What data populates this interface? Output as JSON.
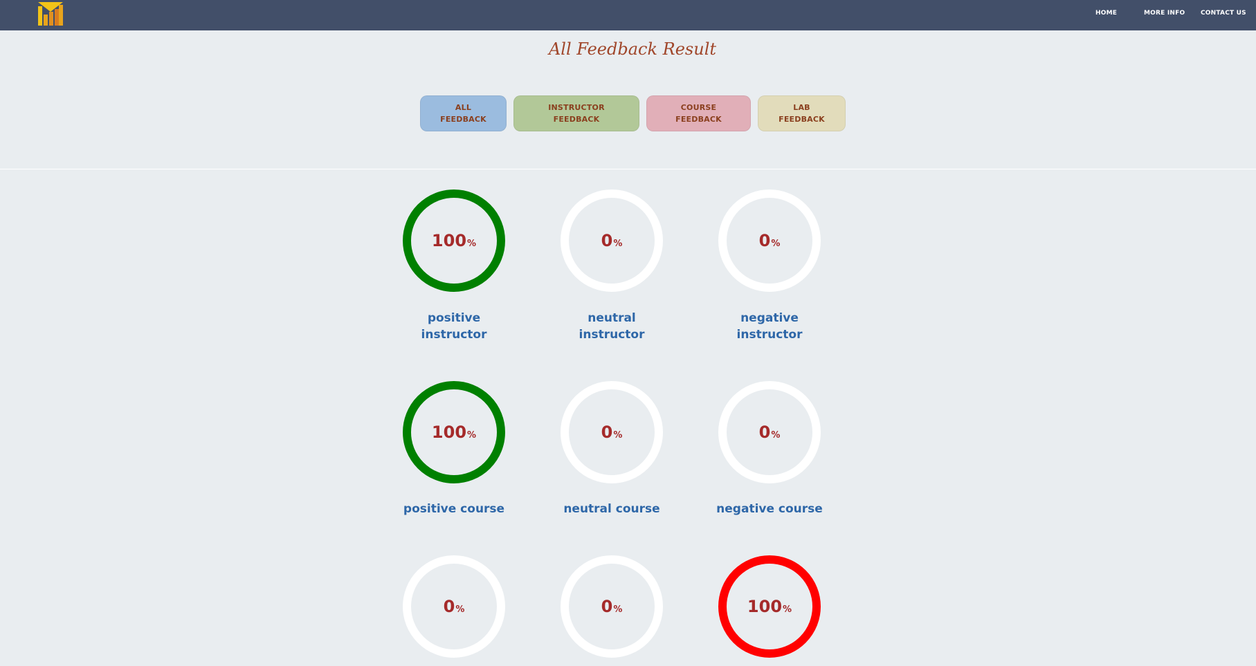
{
  "navbar": {
    "logo_icon": "bar-chart-logo-icon",
    "links": [
      {
        "label": "HOME"
      },
      {
        "label": "MORE INFO"
      },
      {
        "label": "CONTACT US"
      }
    ]
  },
  "page_title": "All Feedback Result",
  "filters": [
    {
      "line1": "ALL",
      "line2": "FEEDBACK",
      "color": "#9bbcdf"
    },
    {
      "line1": "INSTRUCTOR",
      "line2": "FEEDBACK",
      "color": "#b2c898"
    },
    {
      "line1": "COURSE",
      "line2": "FEEDBACK",
      "color": "#e1afb8"
    },
    {
      "line1": "LAB",
      "line2": "FEEDBACK",
      "color": "#e2dcbb"
    }
  ],
  "colors": {
    "positive": "#008000",
    "negative": "#ff0000",
    "empty_ring": "#ffffff",
    "value_text": "#a52a2a",
    "label_text": "#2e67a8"
  },
  "gauges": [
    {
      "value": "100",
      "unit": "%",
      "percent": 100,
      "tone": "positive",
      "label1": "positive",
      "label2": "instructor"
    },
    {
      "value": "0",
      "unit": "%",
      "percent": 0,
      "tone": "neutral",
      "label1": "neutral",
      "label2": "instructor"
    },
    {
      "value": "0",
      "unit": "%",
      "percent": 0,
      "tone": "negative",
      "label1": "negative",
      "label2": "instructor"
    },
    {
      "value": "100",
      "unit": "%",
      "percent": 100,
      "tone": "positive",
      "label1": "positive course",
      "label2": ""
    },
    {
      "value": "0",
      "unit": "%",
      "percent": 0,
      "tone": "neutral",
      "label1": "neutral course",
      "label2": ""
    },
    {
      "value": "0",
      "unit": "%",
      "percent": 0,
      "tone": "negative",
      "label1": "negative course",
      "label2": ""
    },
    {
      "value": "0",
      "unit": "%",
      "percent": 0,
      "tone": "positive",
      "label1": "",
      "label2": ""
    },
    {
      "value": "0",
      "unit": "%",
      "percent": 0,
      "tone": "neutral",
      "label1": "",
      "label2": ""
    },
    {
      "value": "100",
      "unit": "%",
      "percent": 100,
      "tone": "negative",
      "label1": "",
      "label2": ""
    }
  ]
}
